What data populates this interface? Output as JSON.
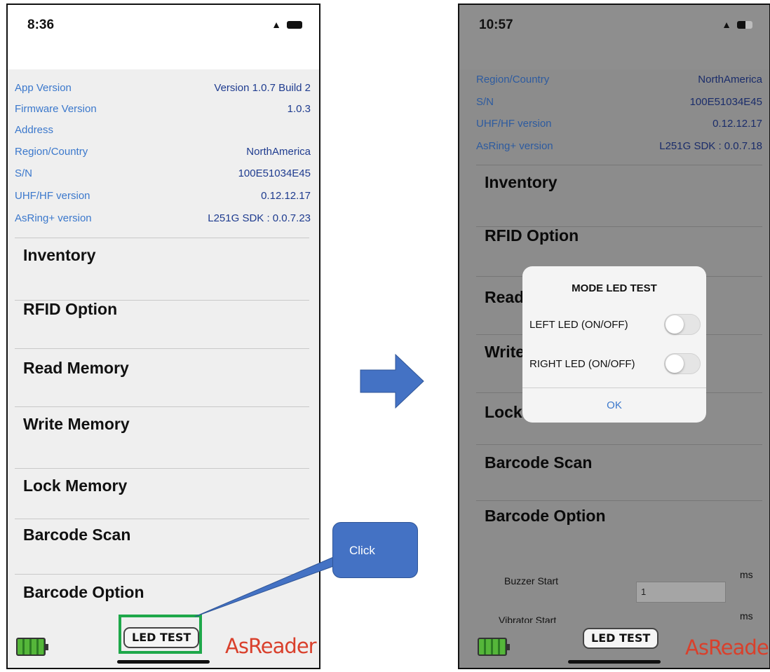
{
  "left_screen": {
    "status": {
      "time": "8:36"
    },
    "info": [
      {
        "label": "App Version",
        "value": "Version 1.0.7 Build 2"
      },
      {
        "label": "Firmware Version",
        "value": "1.0.3"
      },
      {
        "label": "Address",
        "value": ""
      },
      {
        "label": "Region/Country",
        "value": "NorthAmerica"
      },
      {
        "label": "S/N",
        "value": "100E51034E45"
      },
      {
        "label": "UHF/HF version",
        "value": "0.12.12.17"
      },
      {
        "label": "AsRing+ version",
        "value": "L251G SDK : 0.0.7.23"
      }
    ],
    "menu": [
      "Inventory",
      "RFID Option",
      "Read Memory",
      "Write Memory",
      "Lock Memory",
      "Barcode Scan",
      "Barcode Option"
    ],
    "footer": {
      "led_button": "LED TEST",
      "brand": "AsReader"
    }
  },
  "annotation": {
    "callout_text": "Click",
    "highlight_color": "#1ea84a",
    "callout_color": "#4472c4"
  },
  "right_screen": {
    "status": {
      "time": "10:57"
    },
    "info": [
      {
        "label": "Region/Country",
        "value": "NorthAmerica"
      },
      {
        "label": "S/N",
        "value": "100E51034E45"
      },
      {
        "label": "UHF/HF version",
        "value": "0.12.12.17"
      },
      {
        "label": "AsRing+ version",
        "value": "L251G SDK : 0.0.7.18"
      }
    ],
    "menu": [
      "Inventory",
      "RFID Option",
      "Read",
      "Write",
      "Lock",
      "Barcode Scan",
      "Barcode Option"
    ],
    "dialog": {
      "title": "MODE LED TEST",
      "left_led_label": "LEFT LED (ON/OFF)",
      "left_led_on": false,
      "right_led_label": "RIGHT LED (ON/OFF)",
      "right_led_on": false,
      "ok_label": "OK"
    },
    "fields": {
      "buzzer_label": "Buzzer Start",
      "buzzer_value": "1",
      "buzzer_unit": "ms",
      "vibrator_label": "Vibrator Start",
      "vibrator_unit": "ms"
    },
    "footer": {
      "led_button": "LED TEST",
      "brand": "AsReader"
    }
  },
  "colors": {
    "brand": "#d9402c",
    "info_label": "#3b78cc",
    "info_value": "#1e3b8f",
    "battery_green": "#55b63a"
  }
}
